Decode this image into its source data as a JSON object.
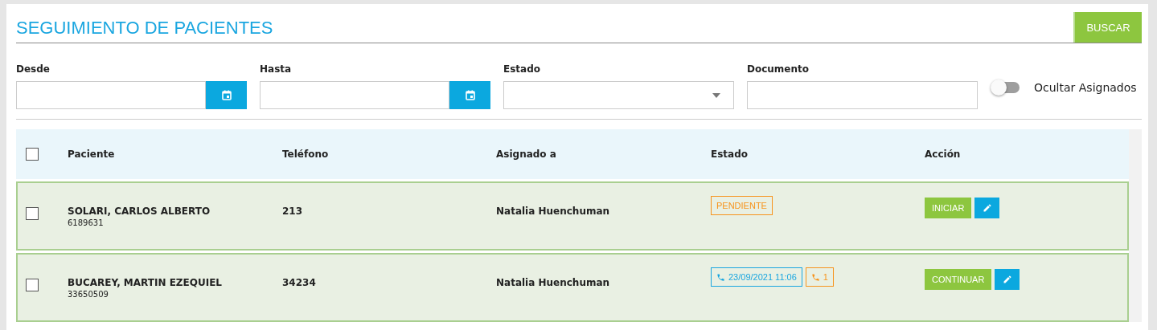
{
  "title": "SEGUIMIENTO DE PACIENTES",
  "search_button": "BUSCAR",
  "filters": [
    {
      "label": "Desde",
      "kind": "date"
    },
    {
      "label": "Hasta",
      "kind": "date"
    },
    {
      "label": "Estado",
      "kind": "select"
    },
    {
      "label": "Documento",
      "kind": "text"
    }
  ],
  "toggle": {
    "label": "Ocultar Asignados",
    "on": false
  },
  "table": {
    "select_all": {
      "checked": false
    },
    "columns": [
      "Paciente",
      "Teléfono",
      "Asignado a",
      "Estado",
      "Acción"
    ],
    "rows": [
      {
        "checked": false,
        "name": "SOLARI, CARLOS ALBERTO",
        "document": "6189631",
        "phone": "213",
        "assigned": "Natalia Huenchuman",
        "status": [
          {
            "kind": "text",
            "text": "PENDIENTE"
          }
        ],
        "action": "INICIAR"
      },
      {
        "checked": false,
        "name": "BUCAREY, MARTIN EZEQUIEL",
        "document": "33650509",
        "phone": "34234",
        "assigned": "Natalia Huenchuman",
        "status": [
          {
            "kind": "call-date",
            "text": "23/09/2021 11:06"
          },
          {
            "kind": "call-count",
            "text": "1"
          }
        ],
        "action": "CONTINUAR"
      }
    ]
  }
}
